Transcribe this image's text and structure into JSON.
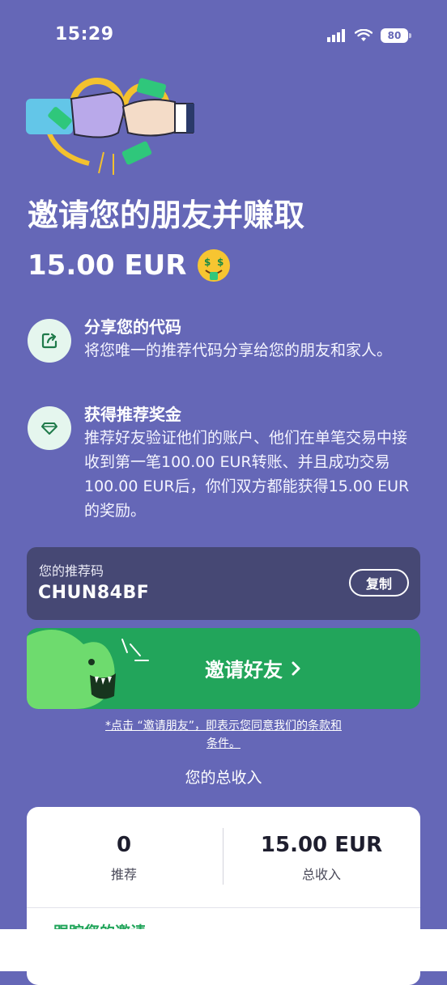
{
  "status_bar": {
    "time": "15:29",
    "battery": "80"
  },
  "hero": {
    "title": "邀请您的朋友并赚取",
    "amount": "15.00 EUR",
    "emoji": "money-mouth-face-icon"
  },
  "steps": [
    {
      "icon": "share-icon",
      "title": "分享您的代码",
      "description": "将您唯一的推荐代码分享给您的朋友和家人。"
    },
    {
      "icon": "diamond-icon",
      "title": "获得推荐奖金",
      "description": "推荐好友验证他们的账户、他们在单笔交易中接收到第一笔100.00 EUR转账、并且成功交易100.00 EUR后，你们双方都能获得15.00 EUR的奖励。"
    }
  ],
  "referral": {
    "label": "您的推荐码",
    "code": "CHUN84BF",
    "copy_label": "复制"
  },
  "invite_button": {
    "label": "邀请好友"
  },
  "terms": {
    "text": "*点击 “邀请朋友”，即表示您同意我们的条款和条件。"
  },
  "earnings": {
    "heading": "您的总收入",
    "referrals_value": "0",
    "referrals_label": "推荐",
    "total_value": "15.00 EUR",
    "total_label": "总收入",
    "track_label": "跟踪您的邀请"
  },
  "colors": {
    "background": "#6567b7",
    "accent": "#22a55b",
    "card_dark": "#464874"
  }
}
